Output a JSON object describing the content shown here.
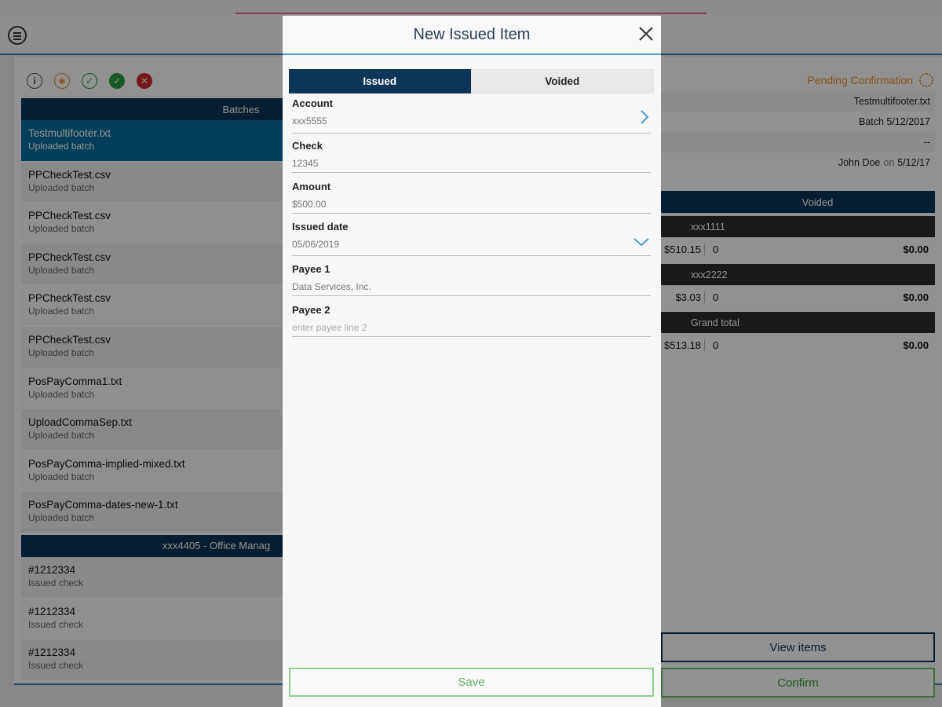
{
  "filters": {
    "icons": [
      "info-icon",
      "pending-icon",
      "check-outline-icon",
      "check-filled-icon",
      "x-icon"
    ]
  },
  "batches": {
    "header": "Batches",
    "items": [
      {
        "name": "Testmultifooter.txt",
        "sub": "Uploaded batch"
      },
      {
        "name": "PPCheckTest.csv",
        "sub": "Uploaded batch"
      },
      {
        "name": "PPCheckTest.csv",
        "sub": "Uploaded batch"
      },
      {
        "name": "PPCheckTest.csv",
        "sub": "Uploaded batch"
      },
      {
        "name": "PPCheckTest.csv",
        "sub": "Uploaded batch"
      },
      {
        "name": "PPCheckTest.csv",
        "sub": "Uploaded batch"
      },
      {
        "name": "PosPayComma1.txt",
        "sub": "Uploaded batch"
      },
      {
        "name": "UploadCommaSep.txt",
        "sub": "Uploaded batch"
      },
      {
        "name": "PosPayComma-implied-mixed.txt",
        "sub": "Uploaded batch"
      },
      {
        "name": "PosPayComma-dates-new-1.txt",
        "sub": "Uploaded batch"
      }
    ]
  },
  "account_section": {
    "header": "xxx4405 - Office Manag",
    "items": [
      {
        "name": "#1212334",
        "sub": "Issued check"
      },
      {
        "name": "#1212334",
        "sub": "Issued check"
      },
      {
        "name": "#1212334",
        "sub": "Issued check"
      }
    ]
  },
  "detail": {
    "status": "Pending Confirmation",
    "rows": [
      {
        "text": "Testmultifooter.txt"
      },
      {
        "text": "Batch 5/12/2017"
      },
      {
        "text": "--"
      },
      {
        "text": "John Doe",
        "muted": "on",
        "text2": "5/12/17"
      }
    ],
    "voided_header": "Voided",
    "groups": [
      {
        "head": "xxx1111",
        "amount": "$510.15",
        "count": "0",
        "total": "$0.00"
      },
      {
        "head": "xxx2222",
        "amount": "$3.03",
        "count": "0",
        "total": "$0.00"
      },
      {
        "head": "Grand total",
        "amount": "$513.18",
        "count": "0",
        "total": "$0.00"
      }
    ],
    "view_items": "View items",
    "confirm": "Confirm"
  },
  "modal": {
    "title": "New Issued Item",
    "tabs": {
      "issued": "Issued",
      "voided": "Voided"
    },
    "fields": {
      "account": {
        "label": "Account",
        "value": "xxx5555"
      },
      "check": {
        "label": "Check",
        "value": "12345"
      },
      "amount": {
        "label": "Amount",
        "value": "$500.00"
      },
      "issued_date": {
        "label": "Issued date",
        "value": "05/06/2019"
      },
      "payee1": {
        "label": "Payee 1",
        "value": "Data Services, Inc."
      },
      "payee2": {
        "label": "Payee 2",
        "placeholder": "enter payee line 2"
      }
    },
    "save": "Save"
  },
  "colors": {
    "navy": "#0c3558",
    "selected": "#0a6b9c",
    "pending": "#e58a2d",
    "save": "#62b062"
  }
}
